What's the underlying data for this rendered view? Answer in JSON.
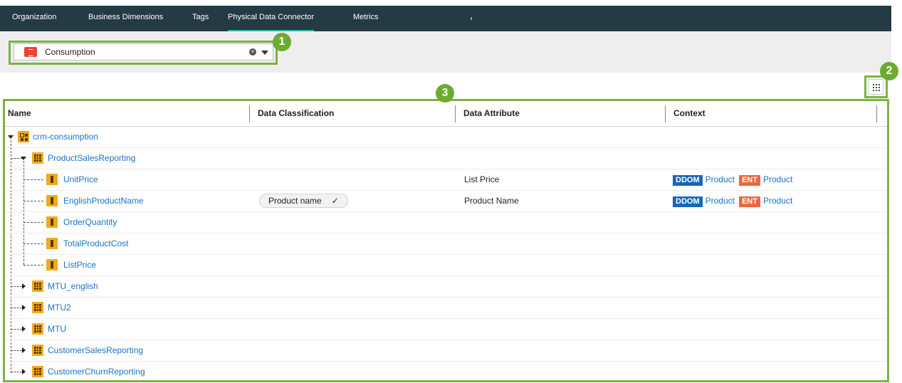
{
  "nav": {
    "tabs": [
      {
        "label": "Organization",
        "active": false
      },
      {
        "label": "Business Dimensions",
        "active": false
      },
      {
        "label": "Tags",
        "active": false
      },
      {
        "label": "Physical Data Connector",
        "active": true
      },
      {
        "label": "Metrics",
        "active": false
      }
    ]
  },
  "datasource": {
    "selected": "Consumption",
    "icon": "database-icon"
  },
  "annotations": {
    "b1": "1",
    "b2": "2",
    "b3": "3"
  },
  "table": {
    "headers": [
      "Name",
      "Data Classification",
      "Data Attribute",
      "Context"
    ],
    "rows": [
      {
        "name": "crm-consumption",
        "type": "schema",
        "classification": "",
        "attribute": "",
        "context": []
      },
      {
        "name": "ProductSalesReporting",
        "type": "table",
        "classification": "",
        "attribute": "",
        "context": []
      },
      {
        "name": "UnitPrice",
        "type": "column",
        "classification": "",
        "attribute": "List Price",
        "context": [
          {
            "tag": "DDOM",
            "label": "Product"
          },
          {
            "tag": "ENT",
            "label": "Product"
          }
        ]
      },
      {
        "name": "EnglishProductName",
        "type": "column",
        "classification": "Product name",
        "attribute": "Product Name",
        "context": [
          {
            "tag": "DDOM",
            "label": "Product"
          },
          {
            "tag": "ENT",
            "label": "Product"
          }
        ]
      },
      {
        "name": "OrderQuantity",
        "type": "column",
        "classification": "",
        "attribute": "",
        "context": []
      },
      {
        "name": "TotalProductCost",
        "type": "column",
        "classification": "",
        "attribute": "",
        "context": []
      },
      {
        "name": "ListPrice",
        "type": "column",
        "classification": "",
        "attribute": "",
        "context": []
      },
      {
        "name": "MTU_english",
        "type": "table",
        "classification": "",
        "attribute": "",
        "context": []
      },
      {
        "name": "MTU2",
        "type": "table",
        "classification": "",
        "attribute": "",
        "context": []
      },
      {
        "name": "MTU",
        "type": "table",
        "classification": "",
        "attribute": "",
        "context": []
      },
      {
        "name": "CustomerSalesReporting",
        "type": "table",
        "classification": "",
        "attribute": "",
        "context": []
      },
      {
        "name": "CustomerChurnReporting",
        "type": "table",
        "classification": "",
        "attribute": "",
        "context": []
      }
    ]
  },
  "colors": {
    "nav_bg": "#243a45",
    "accent": "#7cb342",
    "link": "#1a73c8",
    "ddom": "#1468b8",
    "ent": "#e86a3e",
    "icon": "#f2a91f"
  }
}
